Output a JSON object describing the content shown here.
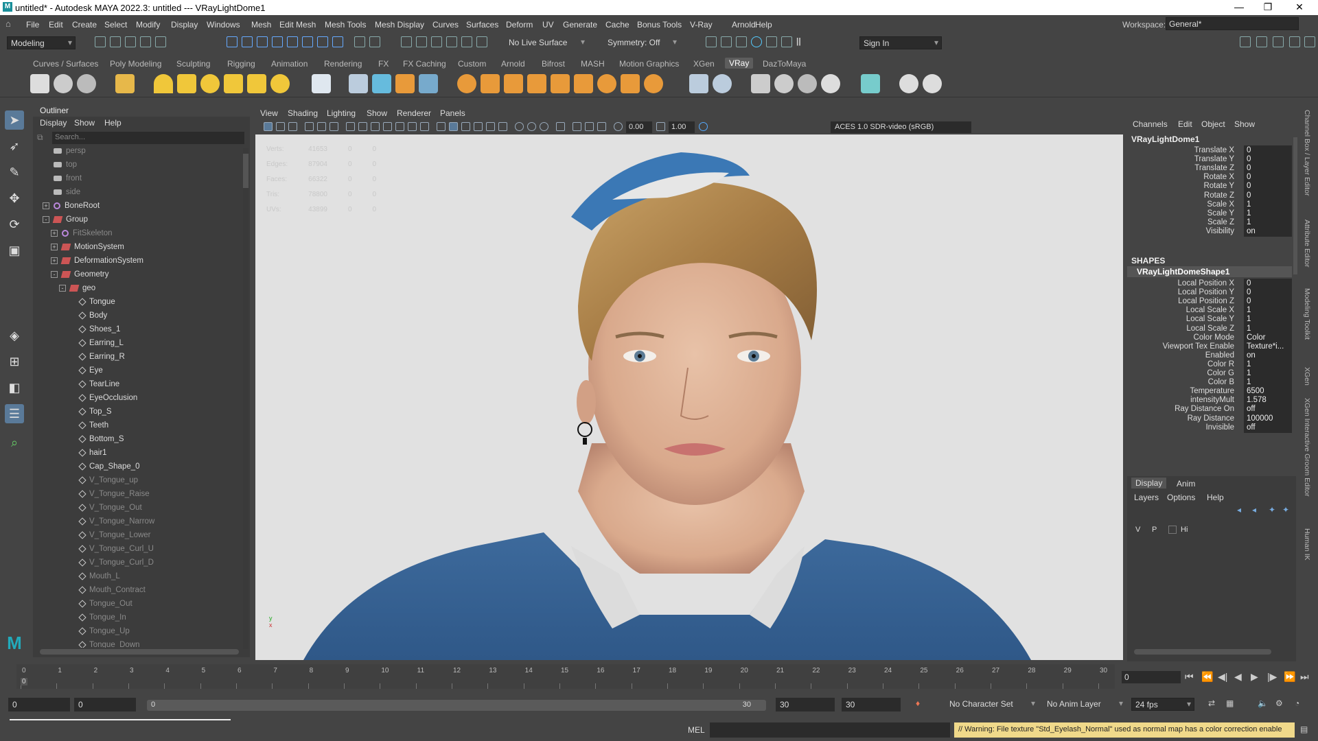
{
  "window": {
    "title": "untitled* - Autodesk MAYA 2022.3: untitled  ---  VRayLightDome1"
  },
  "menu": [
    "File",
    "Edit",
    "Create",
    "Select",
    "Modify",
    "Display",
    "Windows",
    "Mesh",
    "Edit Mesh",
    "Mesh Tools",
    "Mesh Display",
    "Curves",
    "Surfaces",
    "Deform",
    "UV",
    "Generate",
    "Cache",
    "Bonus Tools",
    "V-Ray",
    "Arnold",
    "Help"
  ],
  "workspace": {
    "label": "Workspace:",
    "value": "General*"
  },
  "toolbar": {
    "mode": "Modeling",
    "live_surface": "No Live Surface",
    "symmetry": "Symmetry: Off",
    "sign_in": "Sign In"
  },
  "shelf_tabs": [
    "Curves / Surfaces",
    "Poly Modeling",
    "Sculpting",
    "Rigging",
    "Animation",
    "Rendering",
    "FX",
    "FX Caching",
    "Custom",
    "Arnold",
    "Bifrost",
    "MASH",
    "Motion Graphics",
    "XGen",
    "VRay",
    "DazToMaya"
  ],
  "shelf_active": "VRay",
  "outliner": {
    "title": "Outliner",
    "menu": [
      "Display",
      "Show",
      "Help"
    ],
    "search_placeholder": "Search...",
    "items": [
      {
        "label": "persp",
        "type": "cam",
        "depth": 0,
        "dim": true
      },
      {
        "label": "top",
        "type": "cam",
        "depth": 0,
        "dim": true
      },
      {
        "label": "front",
        "type": "cam",
        "depth": 0,
        "dim": true
      },
      {
        "label": "side",
        "type": "cam",
        "depth": 0,
        "dim": true
      },
      {
        "label": "BoneRoot",
        "type": "joint",
        "depth": 0,
        "exp": "+"
      },
      {
        "label": "Group",
        "type": "grp",
        "depth": 0,
        "exp": "-"
      },
      {
        "label": "FitSkeleton",
        "type": "joint",
        "depth": 1,
        "exp": "+",
        "dim": true
      },
      {
        "label": "MotionSystem",
        "type": "grp",
        "depth": 1,
        "exp": "+"
      },
      {
        "label": "DeformationSystem",
        "type": "grp",
        "depth": 1,
        "exp": "+"
      },
      {
        "label": "Geometry",
        "type": "grp",
        "depth": 1,
        "exp": "-"
      },
      {
        "label": "geo",
        "type": "grp",
        "depth": 2,
        "exp": "-"
      },
      {
        "label": "Tongue",
        "type": "mesh",
        "depth": 3
      },
      {
        "label": "Body",
        "type": "mesh",
        "depth": 3
      },
      {
        "label": "Shoes_1",
        "type": "mesh",
        "depth": 3
      },
      {
        "label": "Earring_L",
        "type": "mesh",
        "depth": 3
      },
      {
        "label": "Earring_R",
        "type": "mesh",
        "depth": 3
      },
      {
        "label": "Eye",
        "type": "mesh",
        "depth": 3
      },
      {
        "label": "TearLine",
        "type": "mesh",
        "depth": 3
      },
      {
        "label": "EyeOcclusion",
        "type": "mesh",
        "depth": 3
      },
      {
        "label": "Top_S",
        "type": "mesh",
        "depth": 3
      },
      {
        "label": "Teeth",
        "type": "mesh",
        "depth": 3
      },
      {
        "label": "Bottom_S",
        "type": "mesh",
        "depth": 3
      },
      {
        "label": "hair1",
        "type": "mesh",
        "depth": 3
      },
      {
        "label": "Cap_Shape_0",
        "type": "mesh",
        "depth": 3
      },
      {
        "label": "V_Tongue_up",
        "type": "mesh",
        "depth": 3,
        "dim": true
      },
      {
        "label": "V_Tongue_Raise",
        "type": "mesh",
        "depth": 3,
        "dim": true
      },
      {
        "label": "V_Tongue_Out",
        "type": "mesh",
        "depth": 3,
        "dim": true
      },
      {
        "label": "V_Tongue_Narrow",
        "type": "mesh",
        "depth": 3,
        "dim": true
      },
      {
        "label": "V_Tongue_Lower",
        "type": "mesh",
        "depth": 3,
        "dim": true
      },
      {
        "label": "V_Tongue_Curl_U",
        "type": "mesh",
        "depth": 3,
        "dim": true
      },
      {
        "label": "V_Tongue_Curl_D",
        "type": "mesh",
        "depth": 3,
        "dim": true
      },
      {
        "label": "Mouth_L",
        "type": "mesh",
        "depth": 3,
        "dim": true
      },
      {
        "label": "Mouth_Contract",
        "type": "mesh",
        "depth": 3,
        "dim": true
      },
      {
        "label": "Tongue_Out",
        "type": "mesh",
        "depth": 3,
        "dim": true
      },
      {
        "label": "Tongue_In",
        "type": "mesh",
        "depth": 3,
        "dim": true
      },
      {
        "label": "Tongue_Up",
        "type": "mesh",
        "depth": 3,
        "dim": true
      },
      {
        "label": "Tongue_Down",
        "type": "mesh",
        "depth": 3,
        "dim": true
      }
    ]
  },
  "viewport": {
    "menu": [
      "View",
      "Shading",
      "Lighting",
      "Show",
      "Renderer",
      "Panels"
    ],
    "exposure": "0.00",
    "gamma": "1.00",
    "color_space": "ACES 1.0 SDR-video (sRGB)",
    "hud": [
      {
        "label": "Verts:",
        "v1": "41653",
        "v2": "0",
        "v3": "0"
      },
      {
        "label": "Edges:",
        "v1": "87904",
        "v2": "0",
        "v3": "0"
      },
      {
        "label": "Faces:",
        "v1": "66322",
        "v2": "0",
        "v3": "0"
      },
      {
        "label": "Tris:",
        "v1": "78800",
        "v2": "0",
        "v3": "0"
      },
      {
        "label": "UVs:",
        "v1": "43899",
        "v2": "0",
        "v3": "0"
      }
    ],
    "axis_x": "x",
    "axis_y": "y"
  },
  "channel_box": {
    "menu": [
      "Channels",
      "Edit",
      "Object",
      "Show"
    ],
    "node": "VRayLightDome1",
    "transform": [
      {
        "label": "Translate X",
        "value": "0"
      },
      {
        "label": "Translate Y",
        "value": "0"
      },
      {
        "label": "Translate Z",
        "value": "0"
      },
      {
        "label": "Rotate X",
        "value": "0"
      },
      {
        "label": "Rotate Y",
        "value": "0"
      },
      {
        "label": "Rotate Z",
        "value": "0"
      },
      {
        "label": "Scale X",
        "value": "1"
      },
      {
        "label": "Scale Y",
        "value": "1"
      },
      {
        "label": "Scale Z",
        "value": "1"
      },
      {
        "label": "Visibility",
        "value": "on"
      }
    ],
    "shapes_header": "SHAPES",
    "shape_node": "VRayLightDomeShape1",
    "shape_attrs": [
      {
        "label": "Local Position X",
        "value": "0"
      },
      {
        "label": "Local Position Y",
        "value": "0"
      },
      {
        "label": "Local Position Z",
        "value": "0"
      },
      {
        "label": "Local Scale X",
        "value": "1"
      },
      {
        "label": "Local Scale Y",
        "value": "1"
      },
      {
        "label": "Local Scale Z",
        "value": "1"
      },
      {
        "label": "Color Mode",
        "value": "Color"
      },
      {
        "label": "Viewport Tex Enable",
        "value": "Texture*i..."
      },
      {
        "label": "Enabled",
        "value": "on"
      },
      {
        "label": "Color R",
        "value": "1"
      },
      {
        "label": "Color G",
        "value": "1"
      },
      {
        "label": "Color B",
        "value": "1"
      },
      {
        "label": "Temperature",
        "value": "6500"
      },
      {
        "label": "intensityMult",
        "value": "1.578"
      },
      {
        "label": "Ray Distance On",
        "value": "off"
      },
      {
        "label": "Ray Distance",
        "value": "100000"
      },
      {
        "label": "Invisible",
        "value": "off"
      }
    ]
  },
  "layer_editor": {
    "tabs": [
      "Display",
      "Anim"
    ],
    "menu": [
      "Layers",
      "Options",
      "Help"
    ],
    "row": {
      "v": "V",
      "p": "P",
      "name": "Hi"
    }
  },
  "side_tabs": [
    "Channel Box / Layer Editor",
    "Attribute Editor",
    "Modeling Toolkit",
    "XGen",
    "XGen Interactive Groom Editor",
    "Human IK"
  ],
  "timeline": {
    "ticks": [
      "0",
      "1",
      "2",
      "3",
      "4",
      "5",
      "6",
      "7",
      "8",
      "9",
      "10",
      "11",
      "12",
      "13",
      "14",
      "15",
      "16",
      "17",
      "18",
      "19",
      "20",
      "21",
      "22",
      "23",
      "24",
      "25",
      "26",
      "27",
      "28",
      "29",
      "30"
    ],
    "current_frame_marker": "0",
    "current_frame": "0"
  },
  "range": {
    "start": "0",
    "anim_start": "0",
    "slider_start": "0",
    "slider_end": "30",
    "anim_end": "30",
    "end": "30",
    "character_set": "No Character Set",
    "anim_layer": "No Anim Layer",
    "fps": "24 fps"
  },
  "command_line": {
    "lang": "MEL",
    "warning": "// Warning: File texture \"Std_Eyelash_Normal\" used as normal map has a color correction enable"
  }
}
